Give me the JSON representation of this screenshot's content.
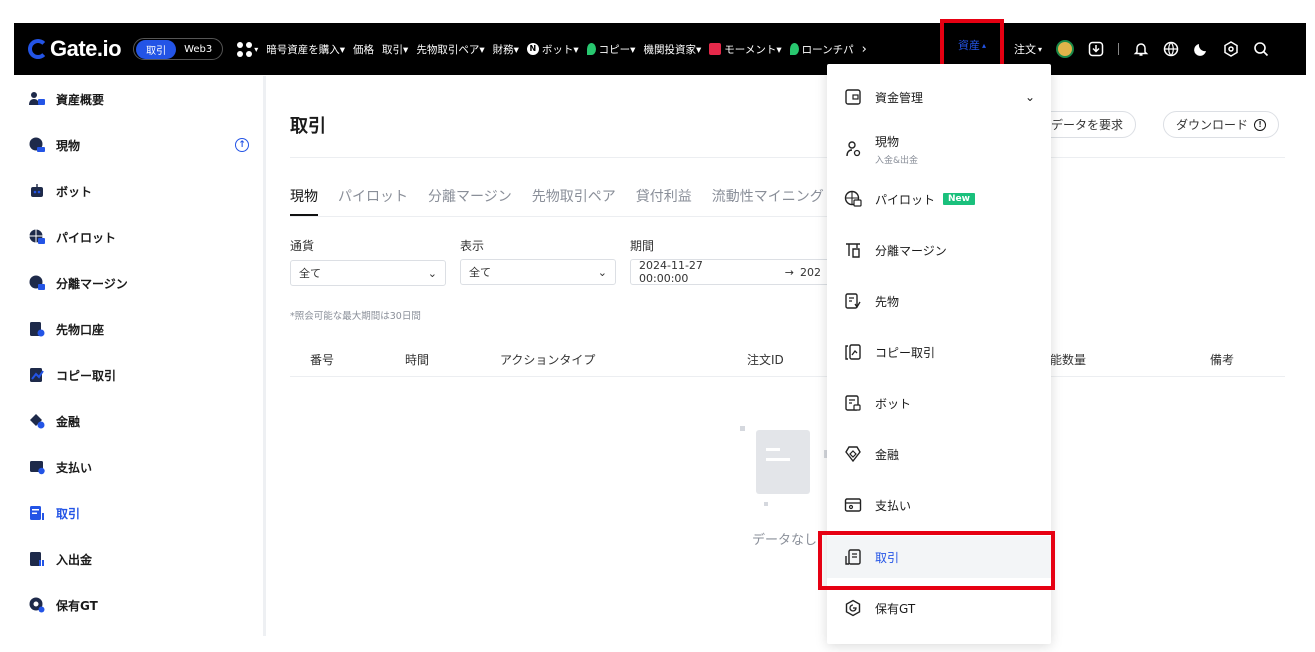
{
  "colors": {
    "accent": "#2354e6",
    "highlight": "#e60012",
    "new_badge": "#1ac07c",
    "nav_bg": "#000000"
  },
  "topnav": {
    "logo_text": "Gate.io",
    "toggle": [
      "取引",
      "Web3"
    ],
    "items": [
      {
        "label": "暗号資産を購入▾",
        "icon": ""
      },
      {
        "label": "価格",
        "icon": ""
      },
      {
        "label": "取引▾",
        "icon": ""
      },
      {
        "label": "先物取引ペア▾",
        "icon": ""
      },
      {
        "label": "財務▾",
        "icon": ""
      },
      {
        "label": "ボット▾",
        "icon": "bot-icon"
      },
      {
        "label": "コピー▾",
        "icon": "leaf-icon"
      },
      {
        "label": "機関投資家▾",
        "icon": ""
      },
      {
        "label": "モーメント▾",
        "icon": "moment-icon"
      },
      {
        "label": "ローンチパ",
        "icon": "leaf-icon"
      }
    ],
    "assets_label": "資産",
    "orders_label": "注文"
  },
  "sidebar": {
    "items": [
      {
        "label": "資産概要",
        "icon": "user-assets-icon"
      },
      {
        "label": "現物",
        "icon": "spot-icon"
      },
      {
        "label": "ボット",
        "icon": "robot-icon"
      },
      {
        "label": "パイロット",
        "icon": "pilot-icon"
      },
      {
        "label": "分離マージン",
        "icon": "margin-icon"
      },
      {
        "label": "先物口座",
        "icon": "futures-icon"
      },
      {
        "label": "コピー取引",
        "icon": "copy-icon"
      },
      {
        "label": "金融",
        "icon": "finance-icon"
      },
      {
        "label": "支払い",
        "icon": "payment-icon"
      },
      {
        "label": "取引",
        "icon": "trade-icon"
      },
      {
        "label": "入出金",
        "icon": "deposit-icon"
      },
      {
        "label": "保有GT",
        "icon": "gt-icon"
      }
    ],
    "active": "取引"
  },
  "main": {
    "title": "取引",
    "request_label": "でデータを要求",
    "download_label": "ダウンロード",
    "tabs": [
      "現物",
      "パイロット",
      "分離マージン",
      "先物取引ペア",
      "貸付利益",
      "流動性マイニング"
    ],
    "filters": {
      "currency_label": "通貨",
      "currency_value": "全て",
      "display_label": "表示",
      "display_value": "全て",
      "period_label": "期間",
      "period_start": "2024-11-27 00:00:00",
      "period_end": "202"
    },
    "note": "*照会可能な最大期間は30日間",
    "columns": [
      "番号",
      "時間",
      "アクションタイプ",
      "注文ID",
      "能数量",
      "備考"
    ],
    "empty_text": "データなし"
  },
  "dropdown": {
    "header": "資金管理",
    "items": [
      {
        "label": "現物",
        "sub": "入金&出金",
        "icon": "spot-user-icon"
      },
      {
        "label": "パイロット",
        "badge": "New",
        "icon": "pilot-globe-icon"
      },
      {
        "label": "分離マージン",
        "icon": "margin-icon"
      },
      {
        "label": "先物",
        "icon": "futures-icon"
      },
      {
        "label": "コピー取引",
        "icon": "copy-trade-icon"
      },
      {
        "label": "ボット",
        "icon": "bot-icon"
      },
      {
        "label": "金融",
        "icon": "finance-icon"
      },
      {
        "label": "支払い",
        "icon": "payment-icon"
      },
      {
        "label": "取引",
        "icon": "trade-icon"
      },
      {
        "label": "保有GT",
        "icon": "gt-icon"
      }
    ]
  }
}
